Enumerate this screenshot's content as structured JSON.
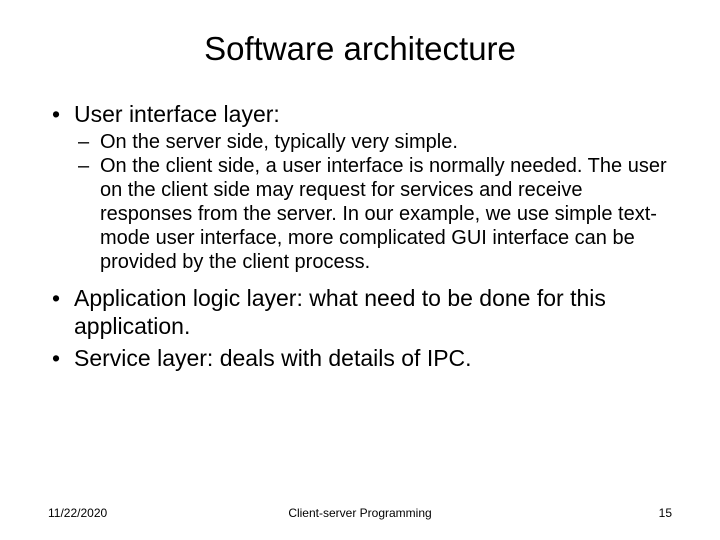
{
  "title": "Software architecture",
  "bullets": {
    "b1": "User interface layer:",
    "b1_sub1": "On the server side, typically very simple.",
    "b1_sub2": "On the client side, a user interface is normally needed. The user on the client side may request for services and receive responses from the server. In our example, we use simple text-mode user interface, more complicated GUI interface can be provided by the client process.",
    "b2": "Application logic layer: what need to be done for this application.",
    "b3": "Service layer: deals with details of IPC."
  },
  "footer": {
    "date": "11/22/2020",
    "center": "Client-server Programming",
    "page": "15"
  }
}
